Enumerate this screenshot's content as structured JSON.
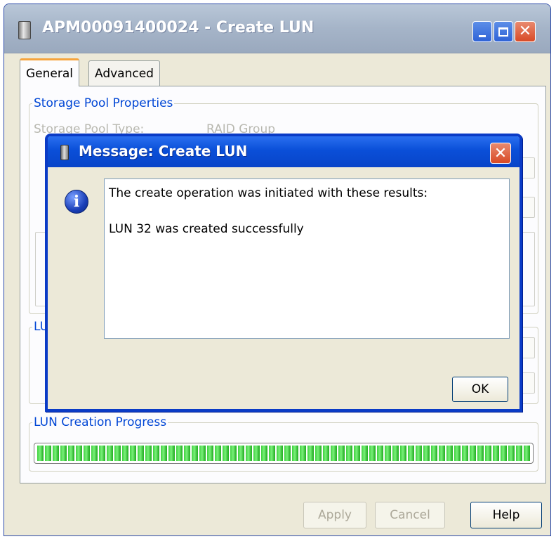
{
  "window": {
    "title": "APM00091400024 - Create LUN",
    "controls": {
      "minimize": "minimize",
      "maximize": "maximize",
      "close": "close"
    }
  },
  "tabs": [
    {
      "label": "General",
      "active": true
    },
    {
      "label": "Advanced",
      "active": false
    }
  ],
  "panel": {
    "pool_group_label": "Storage Pool Properties",
    "pool_type_label": "Storage Pool Type:",
    "pool_type_value": "RAID Group",
    "lun_group_label": "LU",
    "progress_group_label": "LUN Creation Progress",
    "progress_fraction": 1.0
  },
  "buttons": {
    "apply": "Apply",
    "cancel": "Cancel",
    "help": "Help"
  },
  "dialog": {
    "title": "Message: Create LUN",
    "line1": "The create operation was initiated with these results:",
    "line2": "LUN 32 was created successfully",
    "ok": "OK",
    "close_glyph": "✕",
    "icon_glyph": "i"
  },
  "colors": {
    "accent": "#0a3bc6",
    "progress": "#2cb52c",
    "legend": "#0046d5"
  }
}
